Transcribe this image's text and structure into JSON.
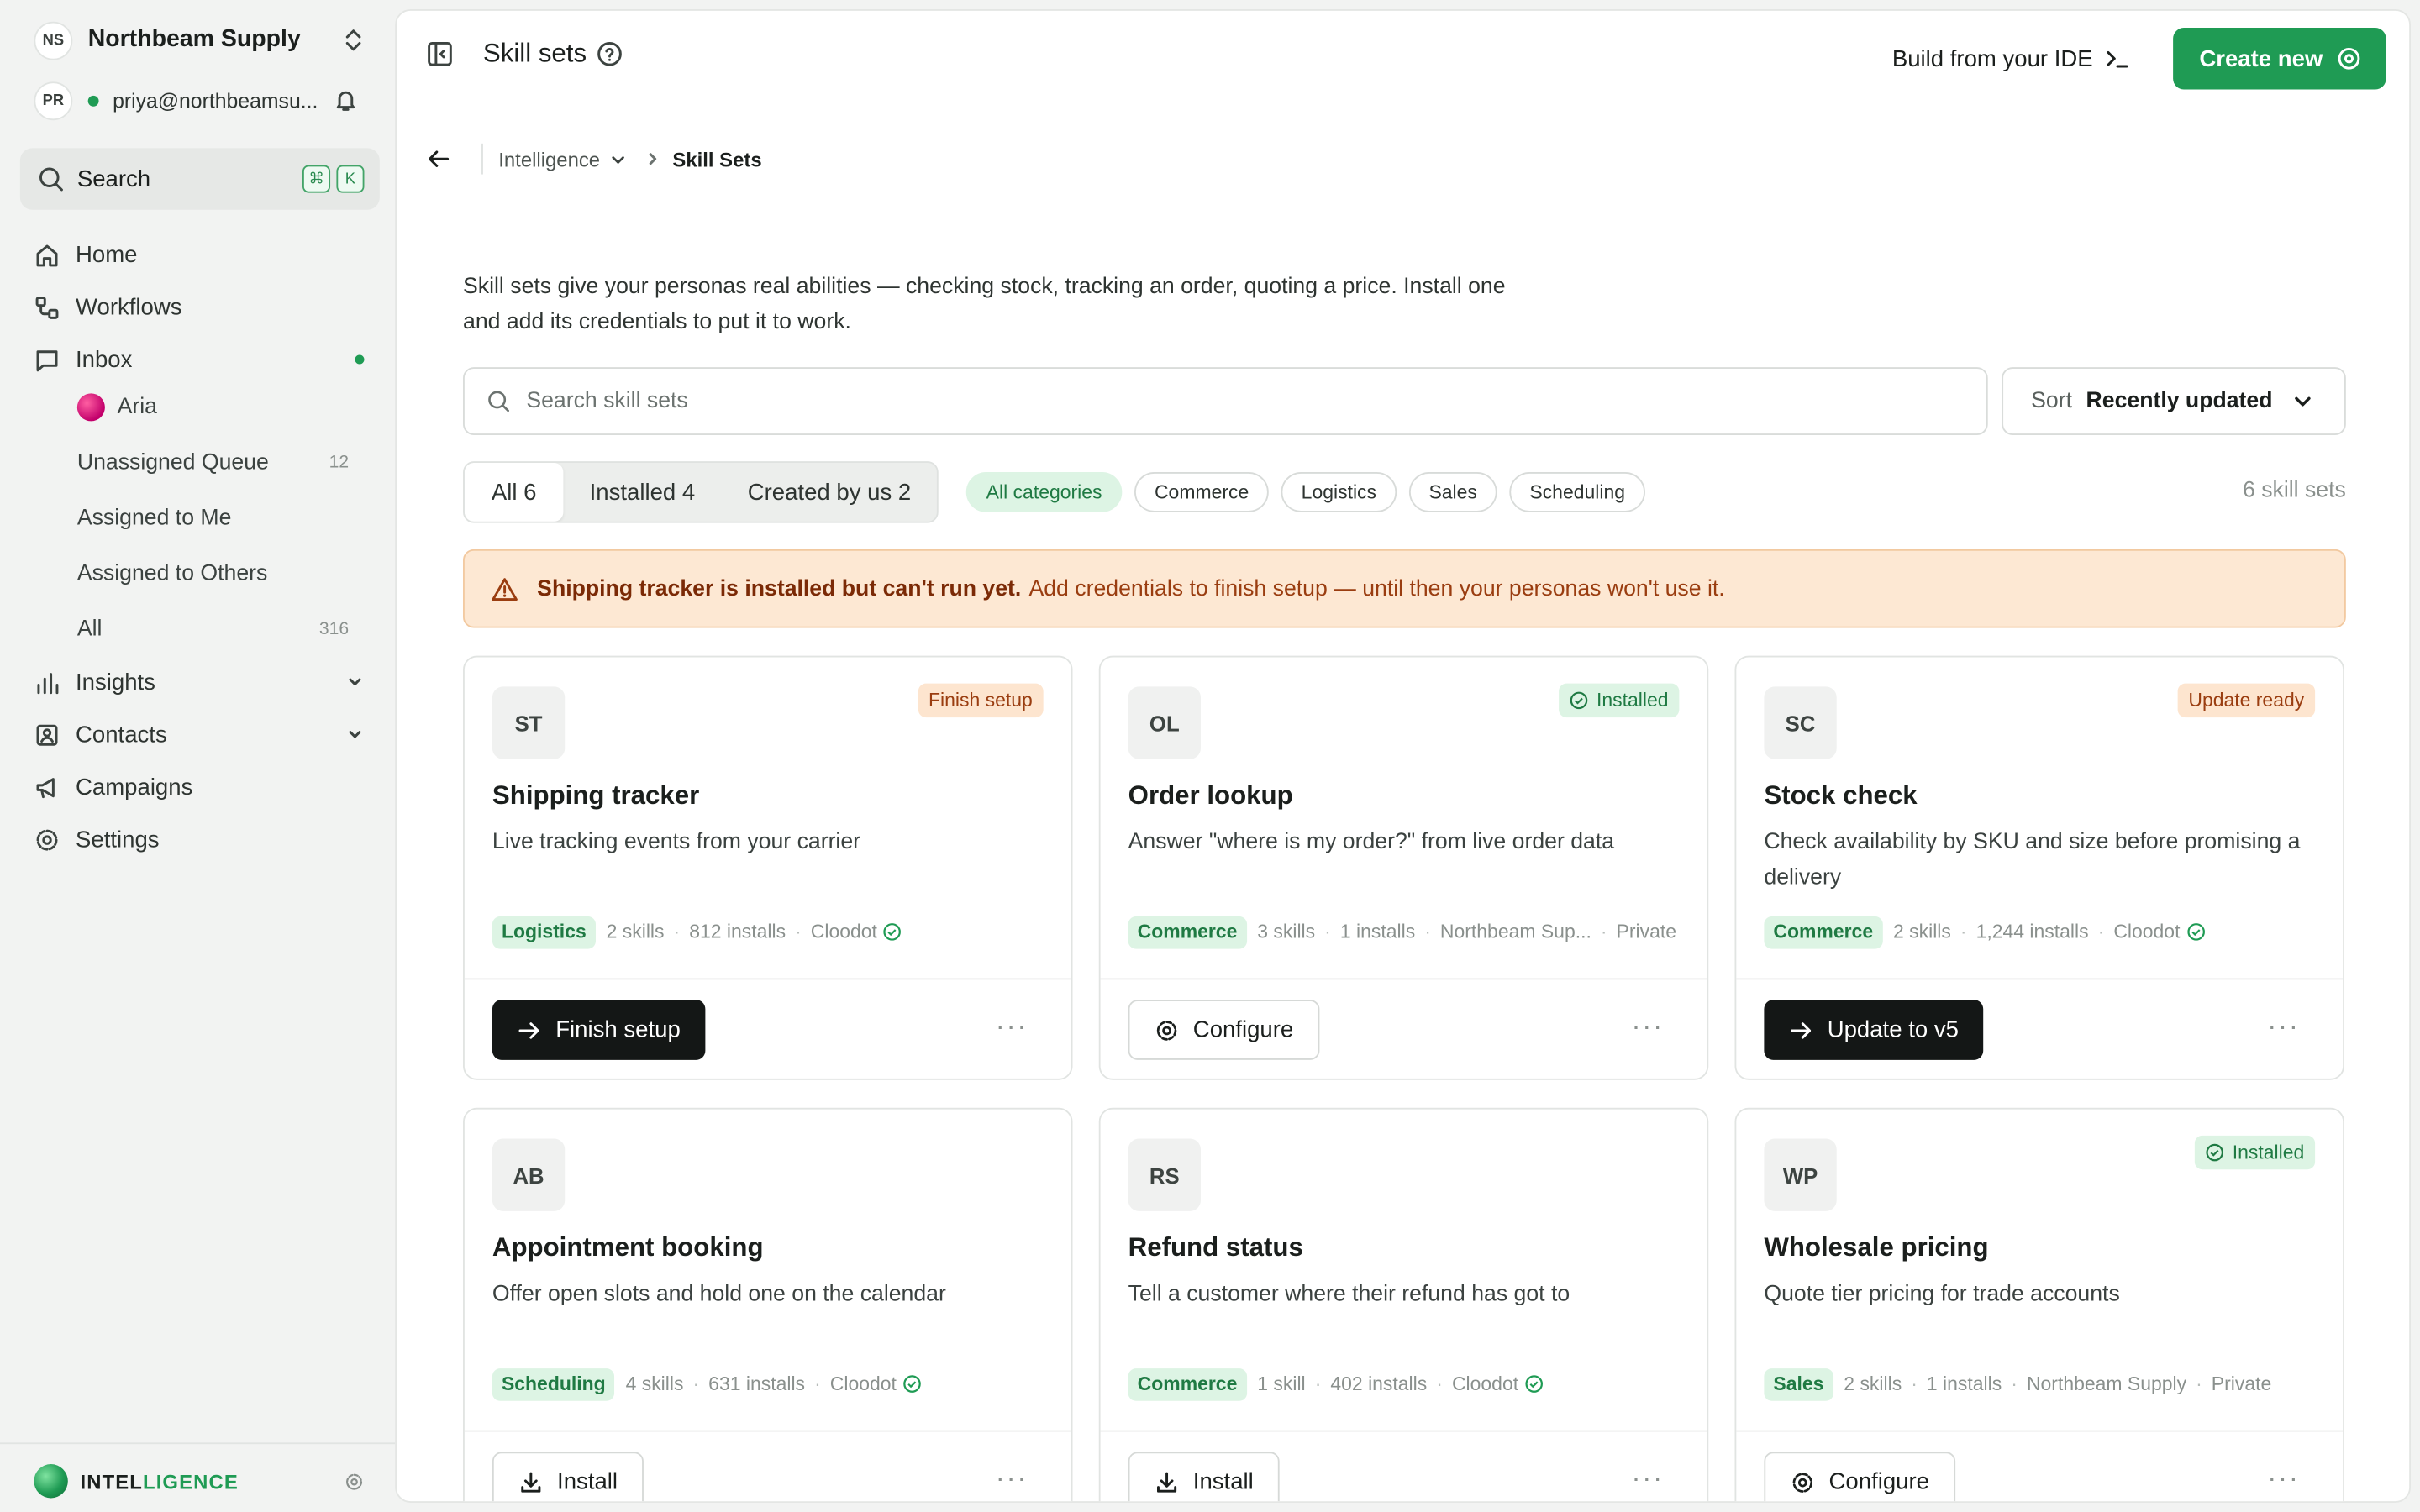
{
  "sidebar": {
    "org_initials": "NS",
    "org_name": "Northbeam Supply",
    "user_initials": "PR",
    "user_email": "priya@northbeamsu...",
    "search_label": "Search",
    "search_keys": [
      "⌘",
      "K"
    ],
    "nav": {
      "home": "Home",
      "workflows": "Workflows",
      "inbox": "Inbox",
      "insights": "Insights",
      "contacts": "Contacts",
      "campaigns": "Campaigns",
      "settings": "Settings"
    },
    "inbox_items": {
      "aria": "Aria",
      "unassigned": {
        "label": "Unassigned Queue",
        "count": "12"
      },
      "assigned_me": "Assigned to Me",
      "assigned_others": "Assigned to Others",
      "all": {
        "label": "All",
        "count": "316"
      }
    },
    "brand": {
      "prefix": "INTEL",
      "suffix": "LIGENCE"
    }
  },
  "header": {
    "title": "Skill sets",
    "ide_label": "Build from your IDE",
    "create_label": "Create new",
    "breadcrumb": {
      "parent": "Intelligence",
      "current": "Skill Sets"
    }
  },
  "content": {
    "intro": "Skill sets give your personas real abilities — checking stock, tracking an order, quoting a price. Install one and add its credentials to put it to work.",
    "search_placeholder": "Search skill sets",
    "sort": {
      "label": "Sort",
      "value": "Recently updated"
    },
    "tabs": [
      {
        "label": "All 6"
      },
      {
        "label": "Installed 4"
      },
      {
        "label": "Created by us 2"
      }
    ],
    "categories": [
      "All categories",
      "Commerce",
      "Logistics",
      "Sales",
      "Scheduling"
    ],
    "total": "6 skill sets",
    "alert": {
      "strong": "Shipping tracker is installed but can't run yet.",
      "text": "Add credentials to finish setup — until then your personas won't use it."
    }
  },
  "cards": [
    {
      "initials": "ST",
      "badge": "Finish setup",
      "name": "Shipping tracker",
      "desc": "Live tracking events from your carrier",
      "category": "Logistics",
      "skills": "2 skills",
      "installs": "812 installs",
      "publisher": "Cloodot",
      "action": "Finish setup"
    },
    {
      "initials": "OL",
      "badge": "Installed",
      "name": "Order lookup",
      "desc": "Answer \"where is my order?\" from live order data",
      "category": "Commerce",
      "skills": "3 skills",
      "installs": "1 installs",
      "publisher": "Northbeam Sup...",
      "visibility": "Private",
      "action": "Configure"
    },
    {
      "initials": "SC",
      "badge": "Update ready",
      "name": "Stock check",
      "desc": "Check availability by SKU and size before promising a delivery",
      "category": "Commerce",
      "skills": "2 skills",
      "installs": "1,244 installs",
      "publisher": "Cloodot",
      "action": "Update to v5"
    },
    {
      "initials": "AB",
      "name": "Appointment booking",
      "desc": "Offer open slots and hold one on the calendar",
      "category": "Scheduling",
      "skills": "4 skills",
      "installs": "631 installs",
      "publisher": "Cloodot",
      "action": "Install"
    },
    {
      "initials": "RS",
      "name": "Refund status",
      "desc": "Tell a customer where their refund has got to",
      "category": "Commerce",
      "skills": "1 skill",
      "installs": "402 installs",
      "publisher": "Cloodot",
      "action": "Install"
    },
    {
      "initials": "WP",
      "badge": "Installed",
      "name": "Wholesale pricing",
      "desc": "Quote tier pricing for trade accounts",
      "category": "Sales",
      "skills": "2 skills",
      "installs": "1 installs",
      "publisher": "Northbeam Supply",
      "visibility": "Private",
      "action": "Configure"
    }
  ],
  "more_glyph": "···",
  "colors": {
    "accent": "#1f9b54",
    "warning_bg": "#fde8d3",
    "warning_text": "#9a3d10",
    "success_bg": "#ddf4e4",
    "success_text": "#1f7a43"
  }
}
